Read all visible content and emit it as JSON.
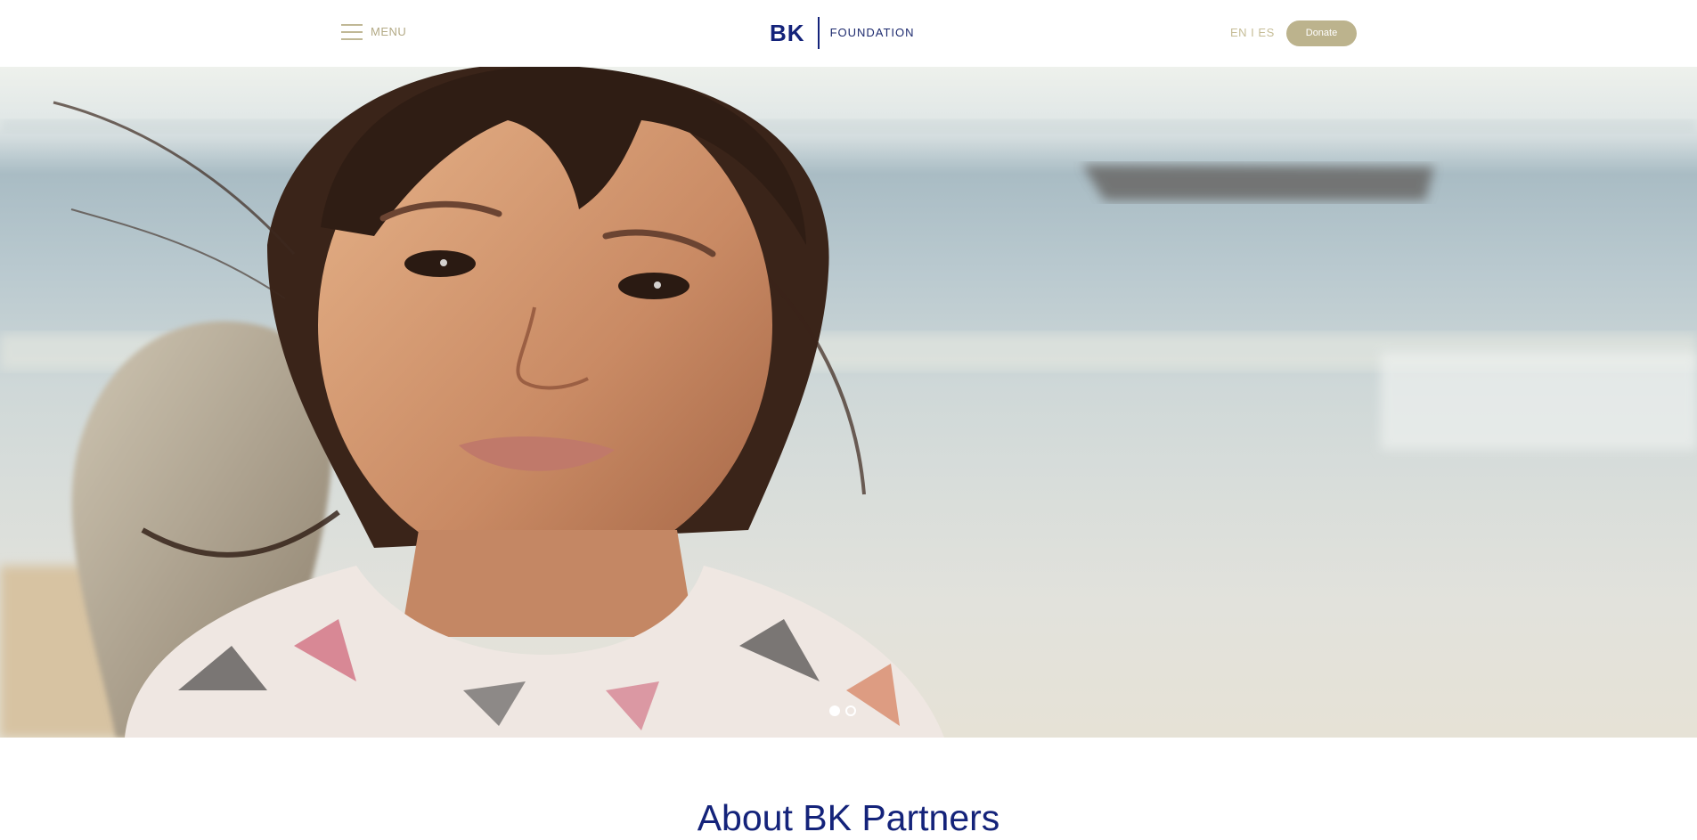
{
  "header": {
    "menu_label": "MENU",
    "logo": {
      "mark": "BK",
      "wordmark": "FOUNDATION"
    },
    "language_switch": "EN I ES",
    "donate_label": "Donate"
  },
  "hero": {
    "image_subject": "smiling girl with windblown hair on a beach",
    "carousel": {
      "slide_count": 2,
      "active_slide": 1
    }
  },
  "about": {
    "title": "About BK Partners"
  },
  "colors": {
    "brand_navy": "#14237a",
    "accent_gold": "#bcb38d"
  },
  "icons": {
    "menu": "hamburger-menu-icon"
  }
}
